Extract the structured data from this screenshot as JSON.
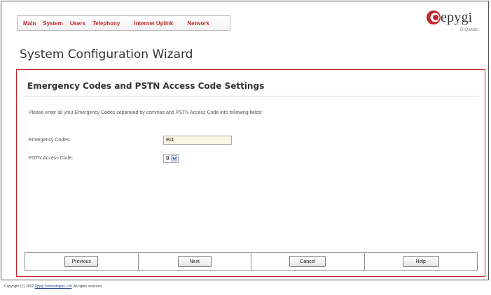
{
  "menu": [
    "Main",
    "System",
    "Users",
    "Telephony",
    "Internet Uplink",
    "Network"
  ],
  "logo": {
    "name": "epygi",
    "sub": "D-Quadro"
  },
  "page_title": "System Configuration Wizard",
  "panel": {
    "title": "Emergency Codes and PSTN Access Code Settings",
    "instructions": "Please enter all your Emergency Codes separated by commas and PSTN Access Code into following fields:",
    "fields": {
      "emergency_label": "Emergency Codes:",
      "emergency_value": "911",
      "pstn_label": "PSTN Access Code:",
      "pstn_value": "9"
    },
    "buttons": {
      "previous": "Previous",
      "next": "Next",
      "cancel": "Cancel",
      "help": "Help"
    }
  },
  "footer": {
    "prefix": "Copyright (C) 2007 ",
    "company": "Epygi Technologies, Ltd",
    "suffix": ". All rights reserved."
  },
  "colors": {
    "accent": "#c0262c",
    "input_bg": "#fbf5e4",
    "panel_border": "#c8202a"
  }
}
